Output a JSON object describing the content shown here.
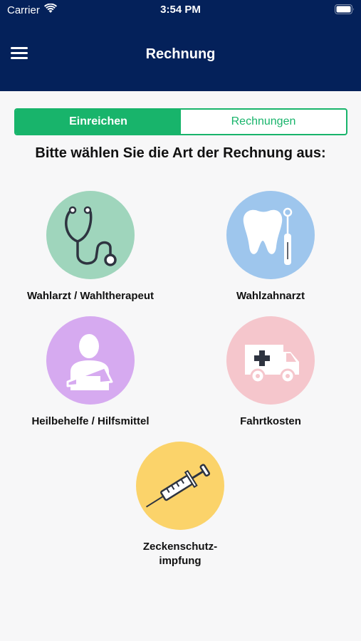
{
  "status_bar": {
    "carrier": "Carrier",
    "time": "3:54 PM"
  },
  "header": {
    "title": "Rechnung",
    "menu_icon": "hamburger-menu-icon"
  },
  "tabs": [
    {
      "label": "Einreichen",
      "active": true
    },
    {
      "label": "Rechnungen",
      "active": false
    }
  ],
  "prompt": "Bitte wählen Sie die Art der Rechnung aus:",
  "options": [
    {
      "label": "Wahlarzt / Wahltherapeut",
      "icon": "stethoscope-icon",
      "color": "#9fd5bc"
    },
    {
      "label": "Wahlzahnarzt",
      "icon": "tooth-icon",
      "color": "#9ec6ed"
    },
    {
      "label": "Heilbehelfe / Hilfsmittel",
      "icon": "arm-sling-icon",
      "color": "#d6aaf0"
    },
    {
      "label": "Fahrtkosten",
      "icon": "ambulance-icon",
      "color": "#f5c6cc"
    },
    {
      "label": "Zeckenschutz-\nimpfung",
      "icon": "syringe-icon",
      "color": "#fbd36a"
    }
  ],
  "colors": {
    "header_bg": "#04215a",
    "accent": "#18b46b",
    "background": "#f7f7f8"
  }
}
